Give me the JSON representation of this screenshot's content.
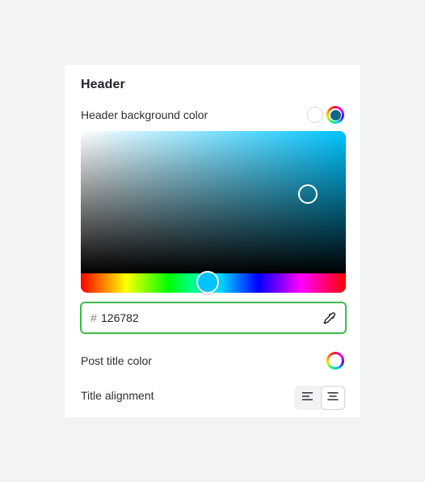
{
  "header": {
    "title": "Header"
  },
  "background_color": {
    "label": "Header background color",
    "swatches": [
      {
        "name": "none",
        "color": "#ffffff"
      },
      {
        "name": "custom",
        "color": "#126782"
      }
    ],
    "picker": {
      "hue_color": "#00c3ff"
    },
    "hex": {
      "prefix": "#",
      "value": "126782",
      "focus_color": "#3dbb4a"
    },
    "eyedropper_icon": "eyedropper-icon"
  },
  "post_title_color": {
    "label": "Post title color",
    "icon": "color-wheel-icon"
  },
  "title_alignment": {
    "label": "Title alignment",
    "options": [
      {
        "name": "left",
        "icon": "align-left-icon",
        "selected": false
      },
      {
        "name": "center",
        "icon": "align-center-icon",
        "selected": true
      }
    ]
  }
}
